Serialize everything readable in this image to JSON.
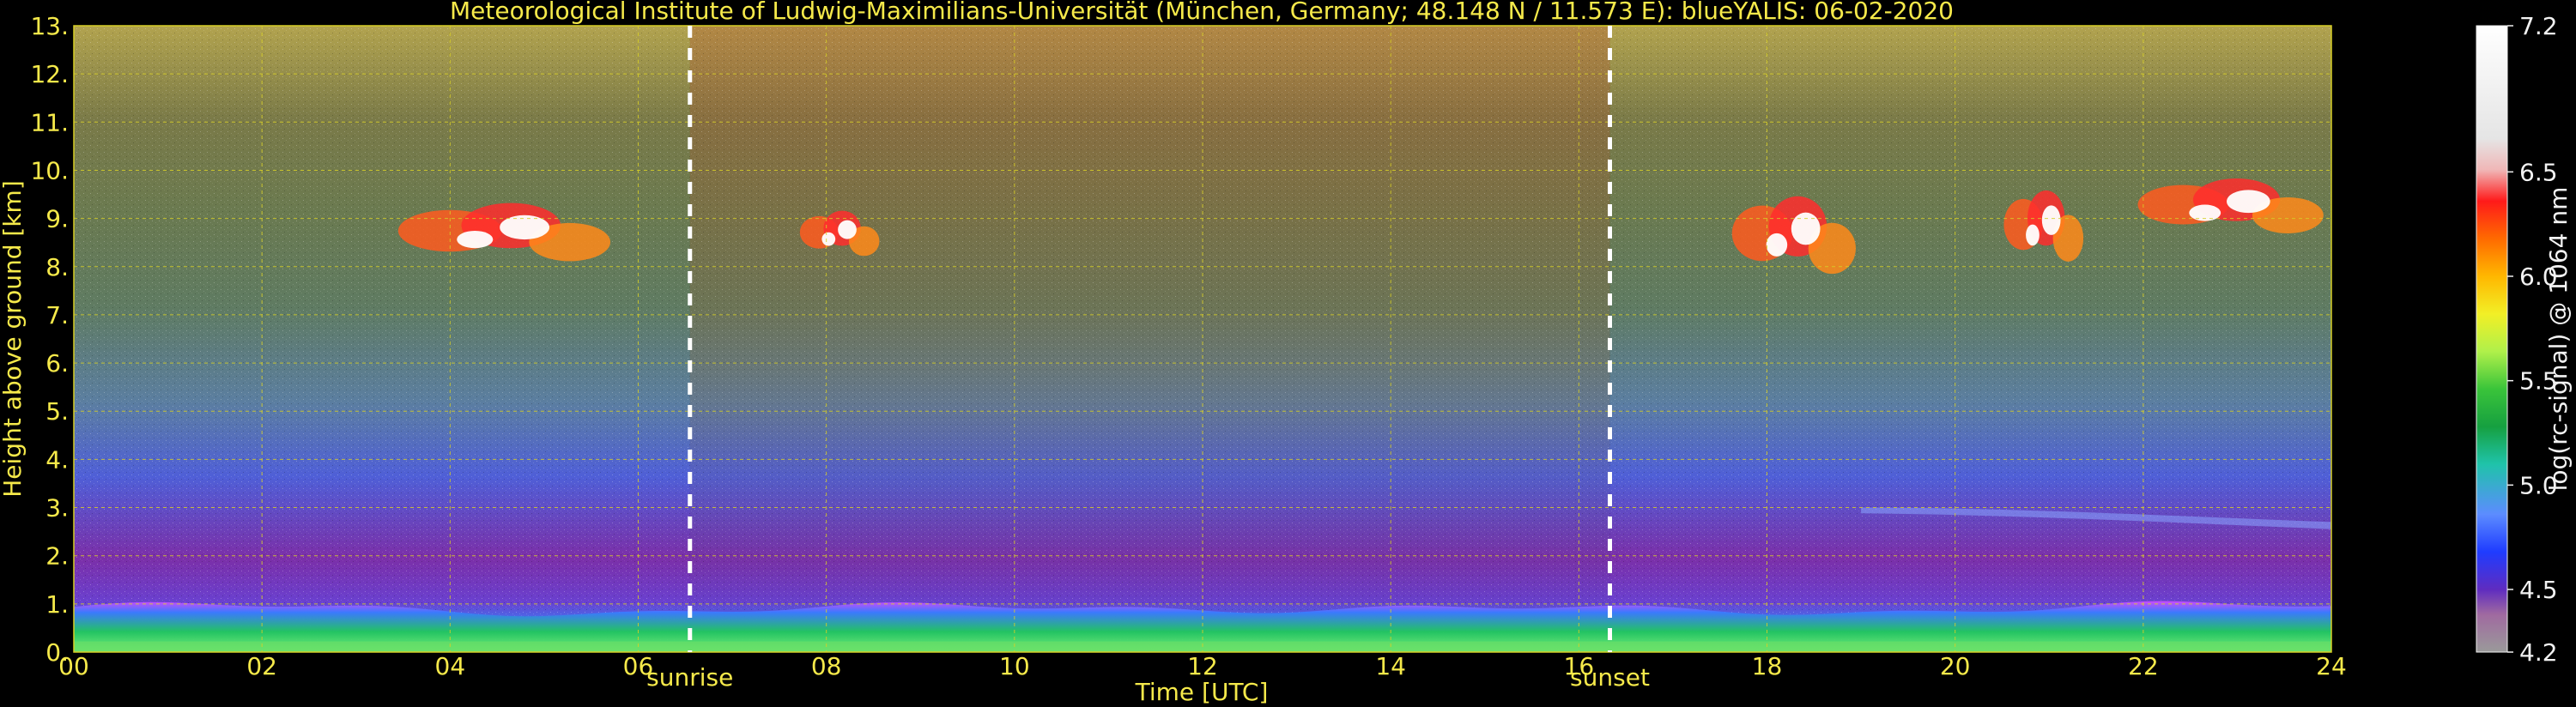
{
  "chart_data": {
    "type": "heatmap",
    "title": "Meteorological Institute of Ludwig-Maximilians-Universität (München, Germany; 48.148 N / 11.573 E):     blueYALIS: 06-02-2020",
    "xlabel": "Time [UTC]",
    "ylabel": "Height above ground [km]",
    "xlim": [
      0,
      24
    ],
    "ylim": [
      0,
      13
    ],
    "x_ticks": [
      "00",
      "02",
      "04",
      "06",
      "08",
      "10",
      "12",
      "14",
      "16",
      "18",
      "20",
      "22",
      "24"
    ],
    "y_ticks": [
      "0.",
      "1.",
      "2.",
      "3.",
      "4.",
      "5.",
      "6.",
      "7.",
      "8.",
      "9.",
      "10.",
      "11.",
      "12.",
      "13."
    ],
    "grid": true,
    "annotations": [
      {
        "text": "sunrise",
        "x": 6.55
      },
      {
        "text": "sunset",
        "x": 16.33
      }
    ],
    "colorbar": {
      "label": "log(rc-signal) @ 1064 nm",
      "range": [
        4.2,
        7.2
      ],
      "ticks": [
        "4.2",
        "4.5",
        "5.0",
        "5.5",
        "6.0",
        "6.5",
        "7.2"
      ]
    },
    "features": {
      "aerosol_layer_top_km": 0.9,
      "clouds": [
        {
          "x_start": 3.4,
          "x_end": 5.8,
          "y_bottom": 7.7,
          "y_top": 9.5
        },
        {
          "x_start": 7.7,
          "x_end": 8.6,
          "y_bottom": 7.9,
          "y_top": 9.3
        },
        {
          "x_start": 17.6,
          "x_end": 19.0,
          "y_bottom": 7.3,
          "y_top": 9.7
        },
        {
          "x_start": 20.5,
          "x_end": 21.4,
          "y_bottom": 7.6,
          "y_top": 9.8
        },
        {
          "x_start": 21.9,
          "x_end": 24.0,
          "y_bottom": 8.3,
          "y_top": 10.0
        }
      ]
    }
  },
  "colors": {
    "text": "#f5e94a",
    "grid": "#d7cf27",
    "white": "#ffffff",
    "background": "#000000"
  }
}
